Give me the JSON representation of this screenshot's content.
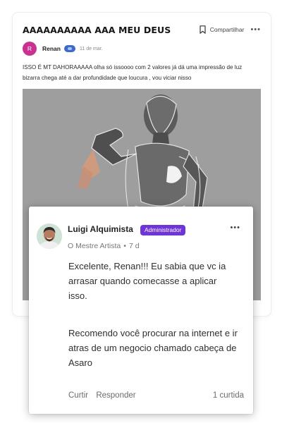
{
  "post": {
    "title": "AAAAAAAAAA AAA MEU DEUS",
    "share_label": "Compartilhar",
    "author": {
      "initial": "R",
      "name": "Renan",
      "avatar_color": "#c9328f",
      "date": "11 de mar."
    },
    "body": "ISSO É MT DAHORAAAAA olha só issoooo com 2 valores já dá uma impressão de luz bizarra chega até a dar profundidade que loucura , vou viciar nisso",
    "image_icon": "grayscale-mannequin-sketch"
  },
  "comment": {
    "author_name": "Luigi Alquimista",
    "role_badge": "Administrador",
    "role_color": "#6f35d6",
    "rank": "O Mestre Artista",
    "meta_separator": "•",
    "time": "7 d",
    "paragraph1": "Excelente, Renan!!! Eu sabia que vc ia arrasar quando comecasse a aplicar isso.",
    "paragraph2": "Recomendo você procurar na internet e ir atras de um negocio chamado cabeça de Asaro",
    "actions": {
      "like": "Curtir",
      "reply": "Responder"
    },
    "like_count": "1 curtida"
  },
  "icons": {
    "bookmark": "bookmark-icon",
    "more": "more-horizontal-icon"
  }
}
